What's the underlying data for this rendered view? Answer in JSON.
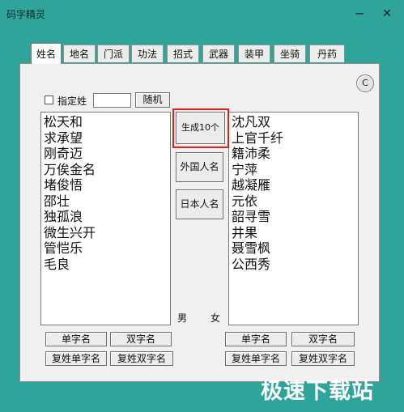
{
  "window": {
    "title": "码字精灵",
    "minimize_icon": "minus",
    "close_icon": "close-x"
  },
  "tabs": [
    {
      "label": "姓名",
      "active": true
    },
    {
      "label": "地名"
    },
    {
      "label": "门派"
    },
    {
      "label": "功法"
    },
    {
      "label": "招式"
    },
    {
      "label": "武器"
    },
    {
      "label": "装甲"
    },
    {
      "label": "坐骑"
    },
    {
      "label": "丹药"
    }
  ],
  "options": {
    "specify_surname_label": "指定姓",
    "surname_value": "",
    "random_label": "随机",
    "c_label": "C"
  },
  "male_names": [
    "松天和",
    "求承望",
    "刚奇迈",
    "万俟金名",
    "堵俊悟",
    "邵壮",
    "独孤浪",
    "微生兴开",
    "管恺乐",
    "毛良"
  ],
  "female_names": [
    "沈凡双",
    "上官千纤",
    "籍沛柔",
    "宁萍",
    "越凝雁",
    "元依",
    "韶寻雪",
    "井果",
    "聂雪枫",
    "公西秀"
  ],
  "center": {
    "generate_label": "生成10个",
    "foreign_label": "外国人名",
    "japanese_label": "日本人名",
    "male_label": "男",
    "female_label": "女"
  },
  "bottom_left": {
    "single": "单字名",
    "double": "双字名",
    "compound_single": "复姓单字名",
    "compound_double": "复姓双字名"
  },
  "bottom_right": {
    "single": "单字名",
    "double": "双字名",
    "compound_single": "复姓单字名",
    "compound_double": "复姓双字名"
  },
  "watermark": "极速下载站",
  "colors": {
    "background": "#2fa49b",
    "highlight_border": "#e0201d",
    "panel": "#f0f0f0"
  }
}
